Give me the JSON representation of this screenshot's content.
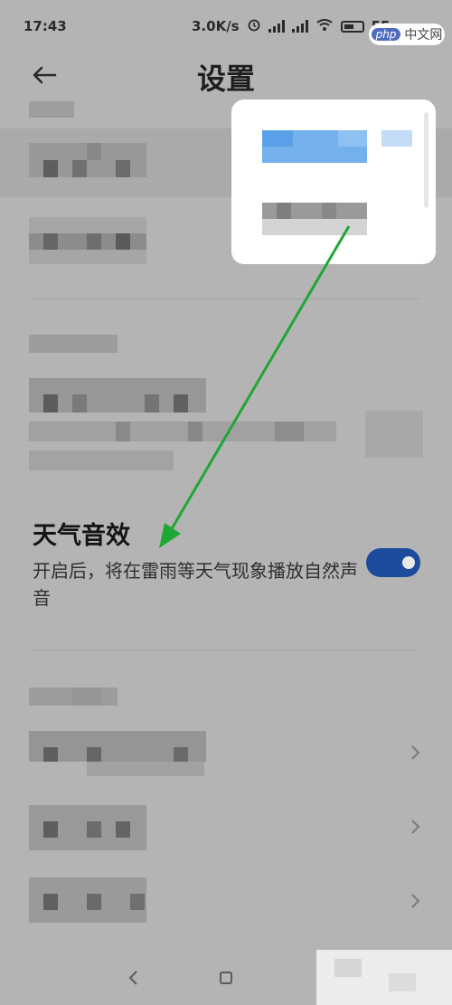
{
  "status_bar": {
    "time": "17:43",
    "speed": "3.0K/s",
    "battery": "55",
    "battery_unit": "%"
  },
  "watermark": {
    "php": "php",
    "text": "中文网"
  },
  "header": {
    "title": "设置",
    "back_icon": "back-arrow-icon"
  },
  "weather_sound": {
    "title": "天气音效",
    "description": "开启后，将在雷雨等天气现象播放自然声音",
    "toggle_on": true
  },
  "colors": {
    "accent": "#1d4c9e",
    "annotation_arrow": "#1fa733"
  }
}
